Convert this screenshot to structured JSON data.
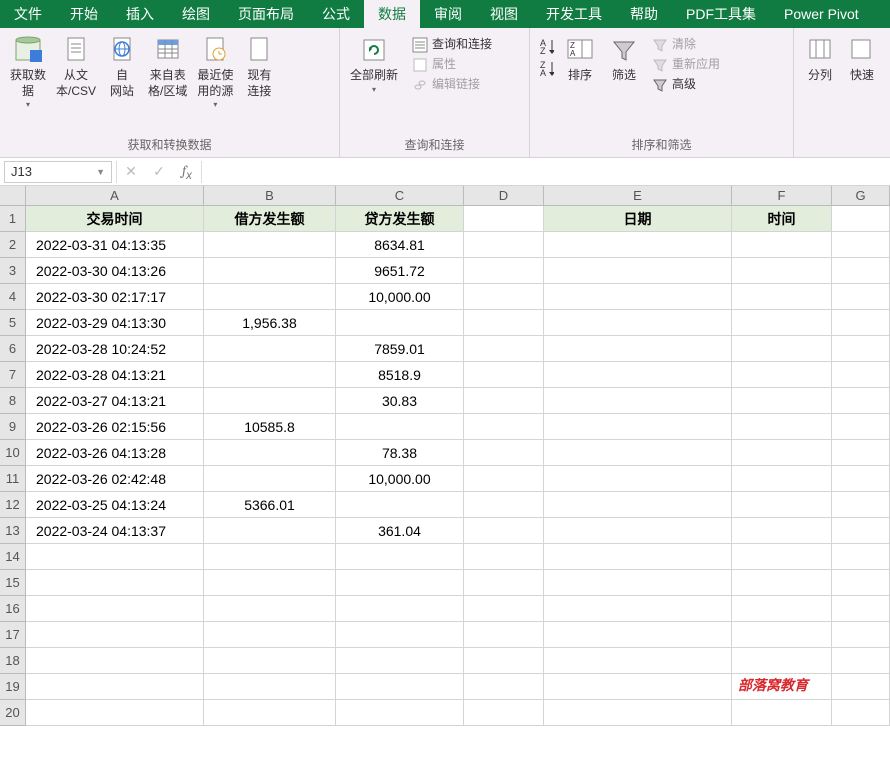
{
  "menu": {
    "items": [
      "文件",
      "开始",
      "插入",
      "绘图",
      "页面布局",
      "公式",
      "数据",
      "审阅",
      "视图",
      "开发工具",
      "帮助",
      "PDF工具集",
      "Power Pivot"
    ],
    "active_index": 6
  },
  "ribbon": {
    "group1": {
      "title": "获取和转换数据",
      "btn_getdata": "获取数\n据",
      "btn_fromcsv": "从文\n本/CSV",
      "btn_fromweb": "自\n网站",
      "btn_fromtable": "来自表\n格/区域",
      "btn_recent": "最近使\n用的源",
      "btn_existing": "现有\n连接"
    },
    "group2": {
      "title": "查询和连接",
      "btn_refresh": "全部刷新",
      "btn_queries": "查询和连接",
      "btn_props": "属性",
      "btn_editlinks": "编辑链接"
    },
    "group3": {
      "title": "排序和筛选",
      "btn_sort": "排序",
      "btn_filter": "筛选",
      "btn_clear": "清除",
      "btn_reapply": "重新应用",
      "btn_advanced": "高级"
    },
    "group4": {
      "btn_ttc": "分列",
      "btn_flash": "快速"
    }
  },
  "namebox": {
    "value": "J13"
  },
  "formula": {
    "value": ""
  },
  "columns": [
    {
      "letter": "A",
      "w": 178
    },
    {
      "letter": "B",
      "w": 132
    },
    {
      "letter": "C",
      "w": 128
    },
    {
      "letter": "D",
      "w": 80
    },
    {
      "letter": "E",
      "w": 188
    },
    {
      "letter": "F",
      "w": 100
    },
    {
      "letter": "G",
      "w": 58
    }
  ],
  "header_row": {
    "A": "交易时间",
    "B": "借方发生额",
    "C": "贷方发生额",
    "D": "",
    "E": "日期",
    "F": "时间"
  },
  "rows": [
    {
      "n": 2,
      "A": "2022-03-31 04:13:35",
      "B": "",
      "C": "8634.81"
    },
    {
      "n": 3,
      "A": "2022-03-30 04:13:26",
      "B": "",
      "C": "9651.72"
    },
    {
      "n": 4,
      "A": "2022-03-30 02:17:17",
      "B": "",
      "C": "10,000.00"
    },
    {
      "n": 5,
      "A": "2022-03-29 04:13:30",
      "B": "1,956.38",
      "C": ""
    },
    {
      "n": 6,
      "A": "2022-03-28 10:24:52",
      "B": "",
      "C": "7859.01"
    },
    {
      "n": 7,
      "A": "2022-03-28 04:13:21",
      "B": "",
      "C": "8518.9"
    },
    {
      "n": 8,
      "A": "2022-03-27 04:13:21",
      "B": "",
      "C": "30.83"
    },
    {
      "n": 9,
      "A": "2022-03-26 02:15:56",
      "B": "10585.8",
      "C": ""
    },
    {
      "n": 10,
      "A": "2022-03-26 04:13:28",
      "B": "",
      "C": "78.38"
    },
    {
      "n": 11,
      "A": "2022-03-26 02:42:48",
      "B": "",
      "C": "10,000.00"
    },
    {
      "n": 12,
      "A": "2022-03-25 04:13:24",
      "B": "5366.01",
      "C": ""
    },
    {
      "n": 13,
      "A": "2022-03-24 04:13:37",
      "B": "",
      "C": "361.04"
    }
  ],
  "empty_rows": [
    14,
    15,
    16,
    17,
    18,
    19,
    20
  ],
  "watermark": {
    "row": 19,
    "col": "F",
    "text": "部落窝教育"
  }
}
